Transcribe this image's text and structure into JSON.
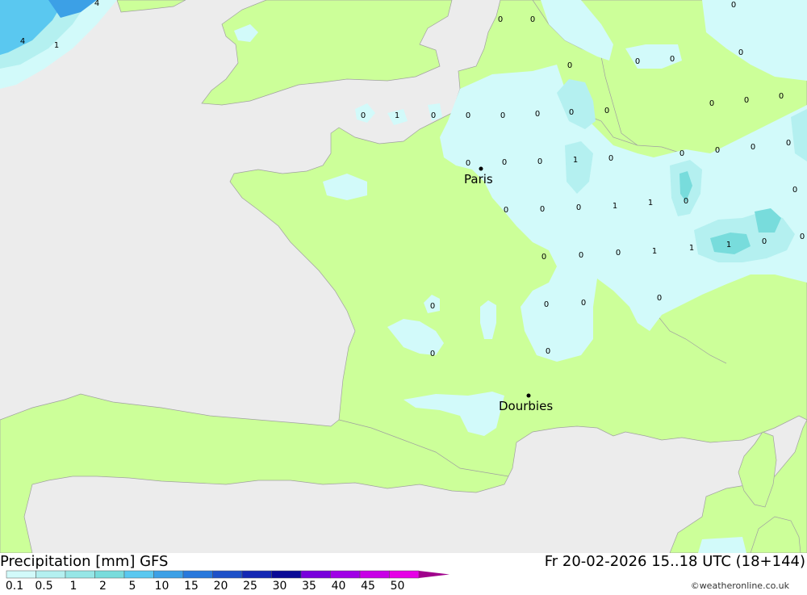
{
  "title": "Precipitation [mm] GFS",
  "datetime": "Fr 20-02-2026 15..18 UTC (18+144)",
  "credit": "©weatheronline.co.uk",
  "cities": [
    {
      "name": "Paris"
    },
    {
      "name": "Dourbies"
    }
  ],
  "legend": {
    "labels": [
      "0.1",
      "0.5",
      "1",
      "2",
      "5",
      "10",
      "15",
      "20",
      "25",
      "30",
      "35",
      "40",
      "45",
      "50"
    ],
    "colors": [
      "#d2fafa",
      "#b4f0f0",
      "#96e6e6",
      "#78dcdc",
      "#5ac8f0",
      "#3ca0e6",
      "#2878dc",
      "#1e50c8",
      "#1428b4",
      "#0a0a96",
      "#7800dc",
      "#a000e6",
      "#c800e6",
      "#e600e6",
      "#a0008c"
    ]
  },
  "colors": {
    "sea": "#ececec",
    "land": "#ccff99",
    "precip_light": "#d2fafa",
    "precip_mid": "#b4f0f0",
    "precip_heavy": "#5ac8f0",
    "border": "#a0a0a0"
  },
  "value_labels": [
    "4",
    "4",
    "1",
    "0",
    "0",
    "0",
    "0",
    "0",
    "0",
    "0",
    "0",
    "1",
    "0",
    "0",
    "0",
    "0",
    "0",
    "0",
    "0",
    "0",
    "0",
    "0",
    "0",
    "0",
    "1",
    "0",
    "0",
    "0",
    "0",
    "0",
    "0",
    "0",
    "0",
    "1",
    "1",
    "0",
    "0",
    "0",
    "0",
    "0",
    "1",
    "1",
    "1",
    "0",
    "0",
    "0",
    "0",
    "0",
    "0",
    "0",
    "0"
  ]
}
